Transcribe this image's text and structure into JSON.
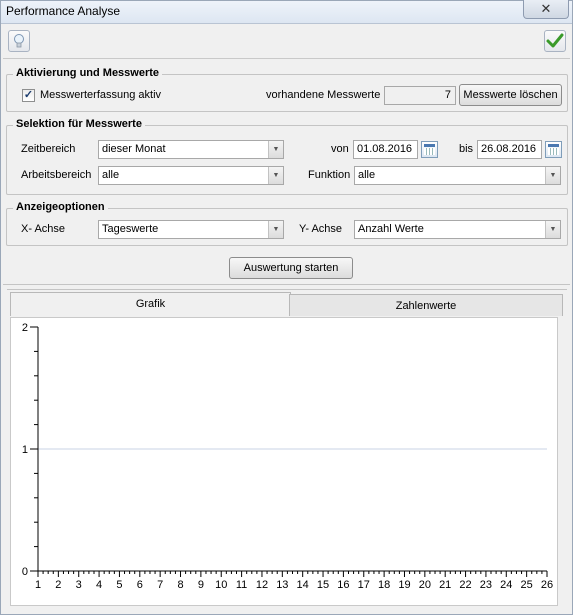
{
  "window": {
    "title": "Performance Analyse",
    "close_glyph": "✕"
  },
  "toolbar": {
    "hint_icon": "lightbulb-icon",
    "ok_icon": "checkmark-icon"
  },
  "activation": {
    "group_title": "Aktivierung und Messwerte",
    "checkbox_label": "Messwerterfassung aktiv",
    "checked": true,
    "check_glyph": "✓",
    "count_label": "vorhandene Messwerte",
    "count_value": "7",
    "delete_button": "Messwerte löschen"
  },
  "selection": {
    "group_title": "Selektion für Messwerte",
    "zeitbereich_label": "Zeitbereich",
    "zeitbereich_value": "dieser Monat",
    "von_label": "von",
    "von_value": "01.08.2016",
    "bis_label": "bis",
    "bis_value": "26.08.2016",
    "arbeitsbereich_label": "Arbeitsbereich",
    "arbeitsbereich_value": "alle",
    "funktion_label": "Funktion",
    "funktion_value": "alle"
  },
  "display": {
    "group_title": "Anzeigeoptionen",
    "x_label": "X- Achse",
    "x_value": "Tageswerte",
    "y_label": "Y- Achse",
    "y_value": "Anzahl Werte"
  },
  "start_button": "Auswertung starten",
  "tabs": [
    {
      "label": "Grafik",
      "active": true
    },
    {
      "label": "Zahlenwerte",
      "active": false
    }
  ],
  "chart_data": {
    "type": "line",
    "title": "",
    "xlabel": "",
    "ylabel": "",
    "x": [
      1,
      2,
      3,
      4,
      5,
      6,
      7,
      8,
      9,
      10,
      11,
      12,
      13,
      14,
      15,
      16,
      17,
      18,
      19,
      20,
      21,
      22,
      23,
      24,
      25,
      26
    ],
    "x_tick_labels": [
      "1",
      "2",
      "3",
      "4",
      "5",
      "6",
      "7",
      "8",
      "9",
      "10",
      "11",
      "12",
      "13",
      "14",
      "15",
      "16",
      "17",
      "18",
      "19",
      "20",
      "21",
      "22",
      "23",
      "24",
      "25",
      "26"
    ],
    "y_ticks": [
      0,
      1,
      2
    ],
    "y_tick_labels": [
      "0",
      "1",
      "2"
    ],
    "ylim": [
      0,
      2
    ],
    "xlim": [
      1,
      26
    ],
    "series": [],
    "reference_line": {
      "y": 1,
      "color": "#c9d3e6"
    },
    "grid": false
  }
}
